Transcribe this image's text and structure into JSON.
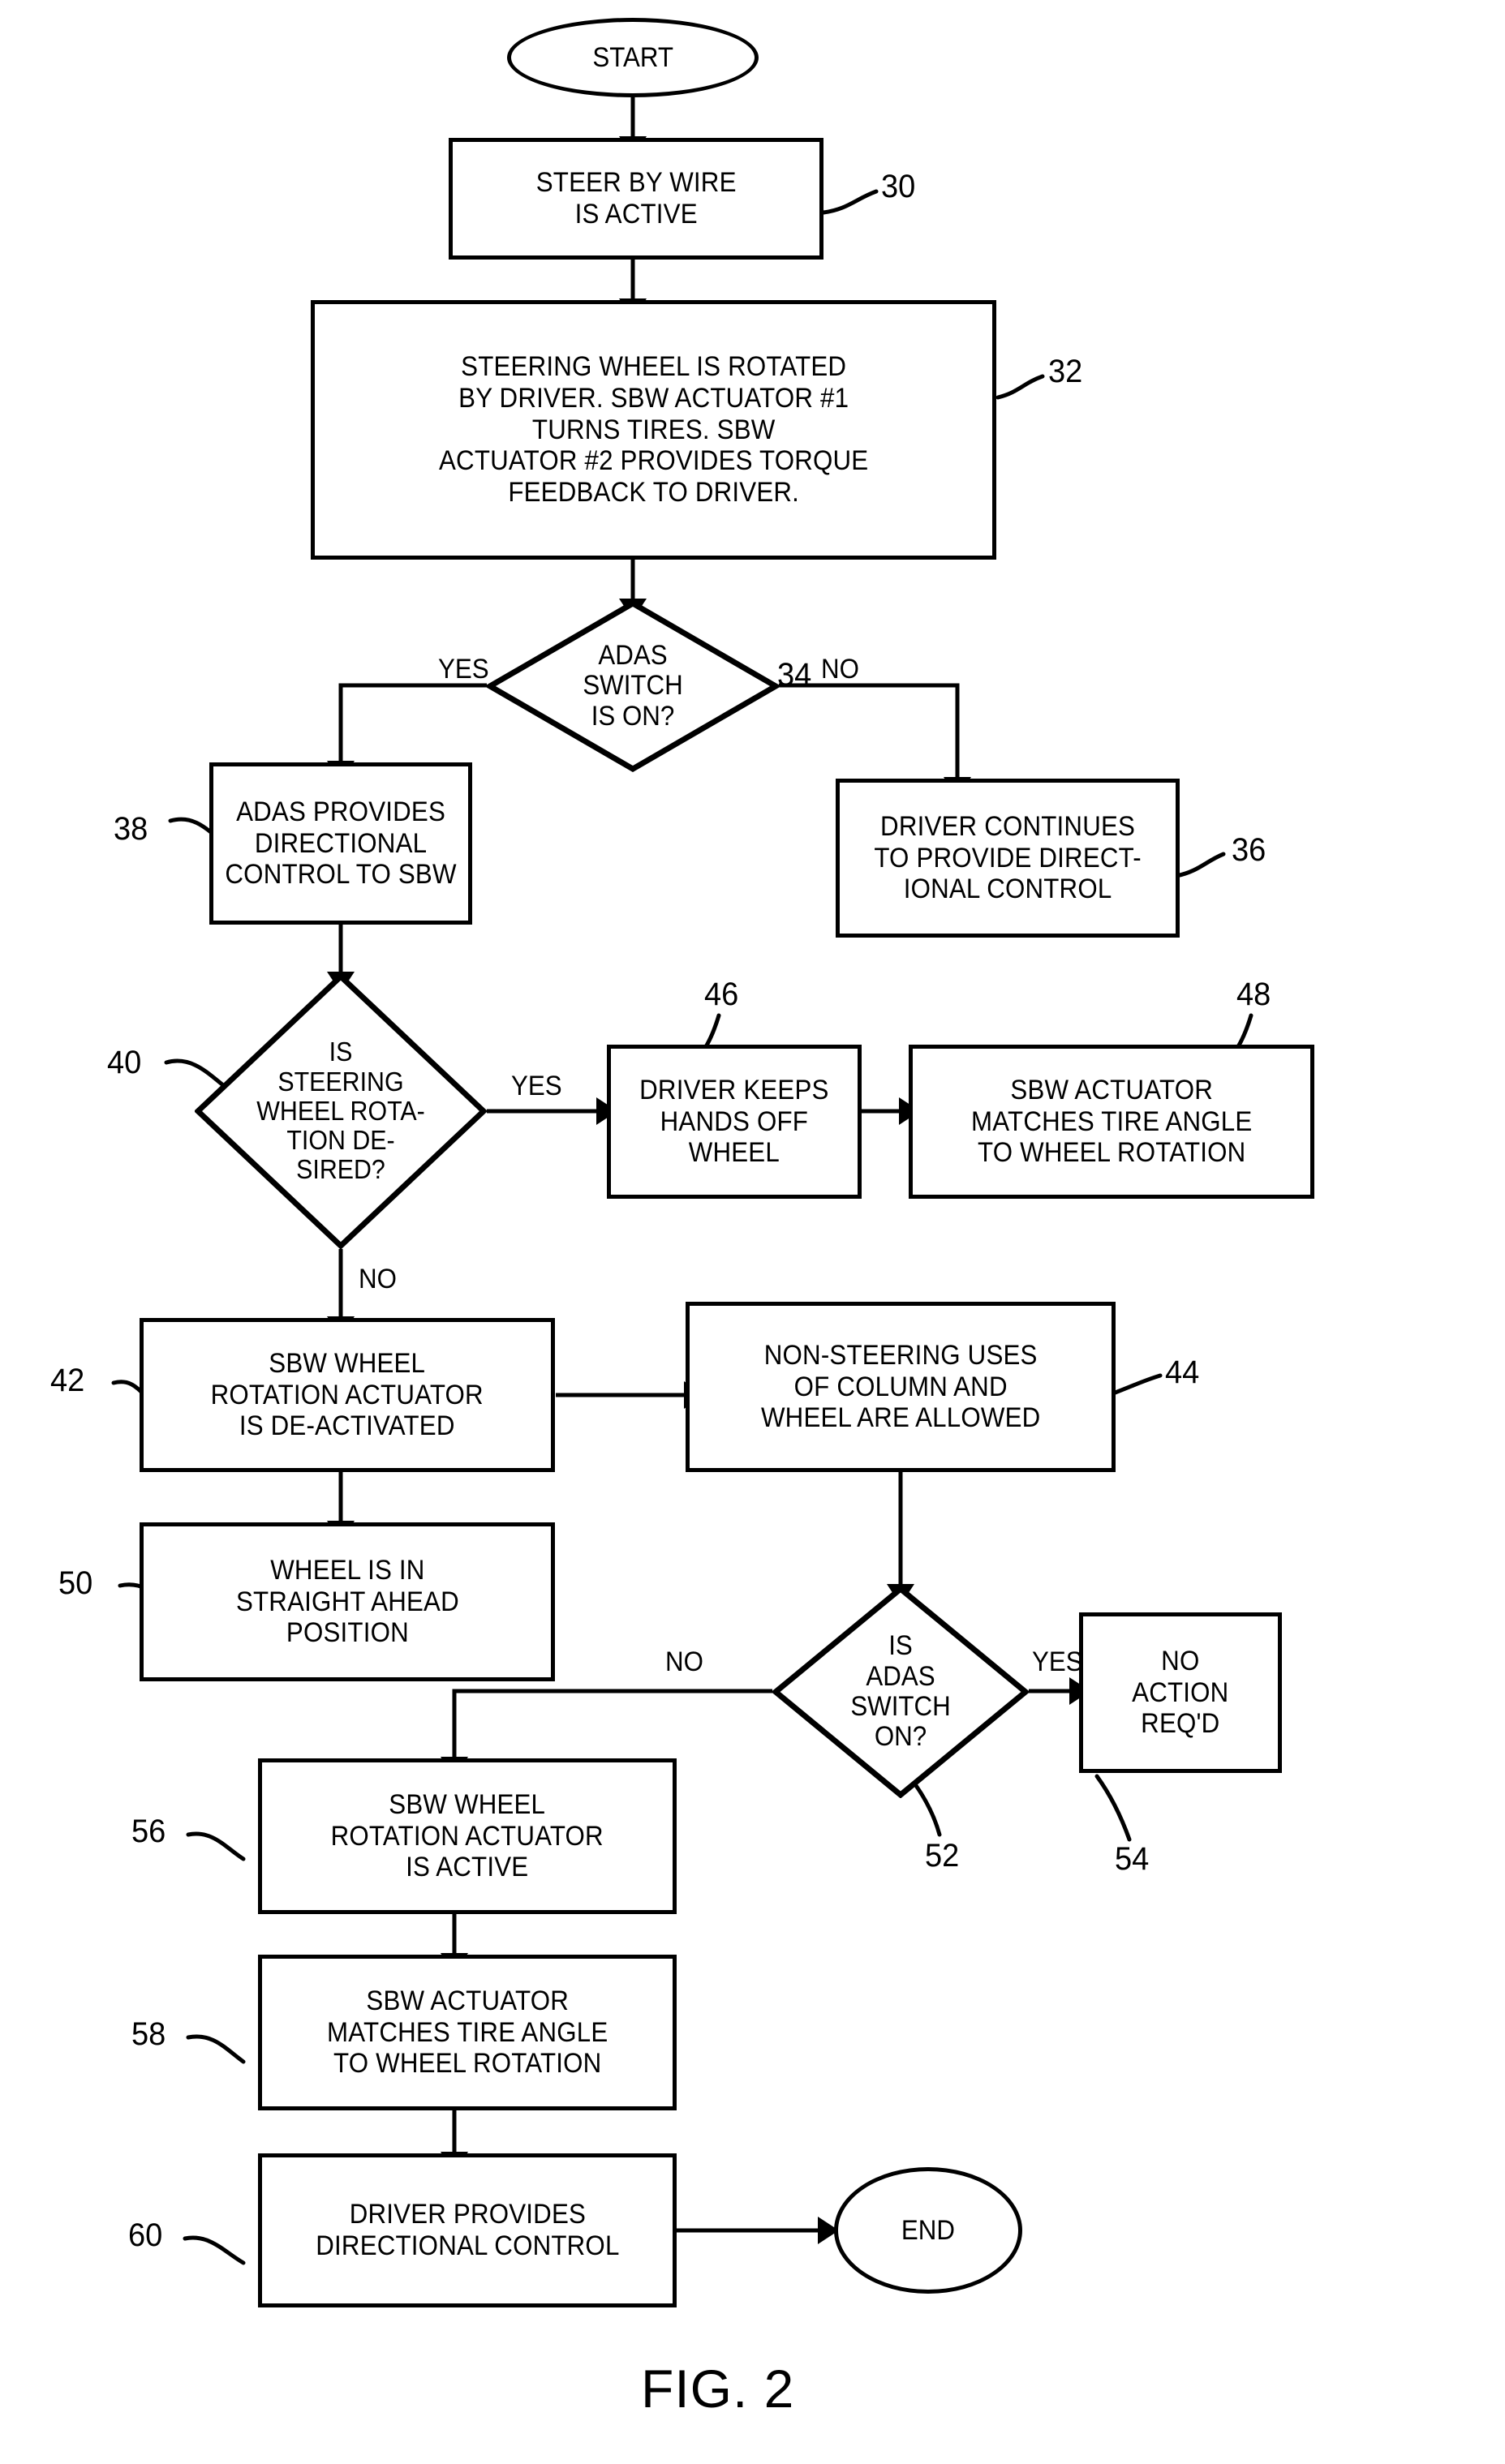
{
  "figure": {
    "caption": "FIG. 2",
    "title": "Steer-by-wire ADAS control flowchart"
  },
  "terminators": {
    "start": "START",
    "end": "END"
  },
  "nodes": [
    {
      "ref": "30",
      "type": "process",
      "text": "STEER BY WIRE\nIS ACTIVE"
    },
    {
      "ref": "32",
      "type": "process",
      "text": "STEERING WHEEL IS ROTATED\nBY DRIVER. SBW ACTUATOR #1\nTURNS TIRES. SBW\nACTUATOR #2 PROVIDES TORQUE\nFEEDBACK TO DRIVER."
    },
    {
      "ref": "34",
      "type": "decision",
      "text": "ADAS\nSWITCH\nIS ON?"
    },
    {
      "ref": "36",
      "type": "process",
      "text": "DRIVER CONTINUES\nTO PROVIDE DIRECT-\nIONAL CONTROL"
    },
    {
      "ref": "38",
      "type": "process",
      "text": "ADAS PROVIDES\nDIRECTIONAL\nCONTROL TO SBW"
    },
    {
      "ref": "40",
      "type": "decision",
      "text": "IS\nSTEERING\nWHEEL ROTA-\nTION DE-\nSIRED?"
    },
    {
      "ref": "42",
      "type": "process",
      "text": "SBW WHEEL\nROTATION ACTUATOR\nIS DE-ACTIVATED"
    },
    {
      "ref": "44",
      "type": "process",
      "text": "NON-STEERING USES\nOF COLUMN AND\nWHEEL ARE ALLOWED"
    },
    {
      "ref": "46",
      "type": "process",
      "text": "DRIVER KEEPS\nHANDS OFF\nWHEEL"
    },
    {
      "ref": "48",
      "type": "process",
      "text": "SBW ACTUATOR\nMATCHES TIRE ANGLE\nTO WHEEL ROTATION"
    },
    {
      "ref": "50",
      "type": "process",
      "text": "WHEEL IS IN\nSTRAIGHT AHEAD\nPOSITION"
    },
    {
      "ref": "52",
      "type": "decision",
      "text": "IS\nADAS\nSWITCH\nON?"
    },
    {
      "ref": "54",
      "type": "process",
      "text": "NO\nACTION\nREQ'D"
    },
    {
      "ref": "56",
      "type": "process",
      "text": "SBW WHEEL\nROTATION ACTUATOR\nIS ACTIVE"
    },
    {
      "ref": "58",
      "type": "process",
      "text": "SBW ACTUATOR\nMATCHES TIRE ANGLE\nTO WHEEL ROTATION"
    },
    {
      "ref": "60",
      "type": "process",
      "text": "DRIVER PROVIDES\nDIRECTIONAL CONTROL"
    }
  ],
  "edge_labels": {
    "d34_yes": "YES",
    "d34_no": "NO",
    "d40_yes": "YES",
    "d40_no": "NO",
    "d52_yes": "YES",
    "d52_no": "NO"
  },
  "chart_data": {
    "type": "flowchart",
    "title": "FIG. 2",
    "orientation": "top-down",
    "edges": [
      {
        "from": "START",
        "to": "30",
        "label": ""
      },
      {
        "from": "30",
        "to": "32",
        "label": ""
      },
      {
        "from": "32",
        "to": "34",
        "label": ""
      },
      {
        "from": "34",
        "to": "38",
        "label": "YES"
      },
      {
        "from": "34",
        "to": "36",
        "label": "NO"
      },
      {
        "from": "38",
        "to": "40",
        "label": ""
      },
      {
        "from": "40",
        "to": "46",
        "label": "YES"
      },
      {
        "from": "46",
        "to": "48",
        "label": ""
      },
      {
        "from": "40",
        "to": "42",
        "label": "NO"
      },
      {
        "from": "42",
        "to": "44",
        "label": ""
      },
      {
        "from": "42",
        "to": "50",
        "label": ""
      },
      {
        "from": "44",
        "to": "52",
        "label": ""
      },
      {
        "from": "52",
        "to": "54",
        "label": "YES"
      },
      {
        "from": "52",
        "to": "56",
        "label": "NO"
      },
      {
        "from": "56",
        "to": "58",
        "label": ""
      },
      {
        "from": "58",
        "to": "60",
        "label": ""
      },
      {
        "from": "60",
        "to": "END",
        "label": ""
      }
    ]
  }
}
